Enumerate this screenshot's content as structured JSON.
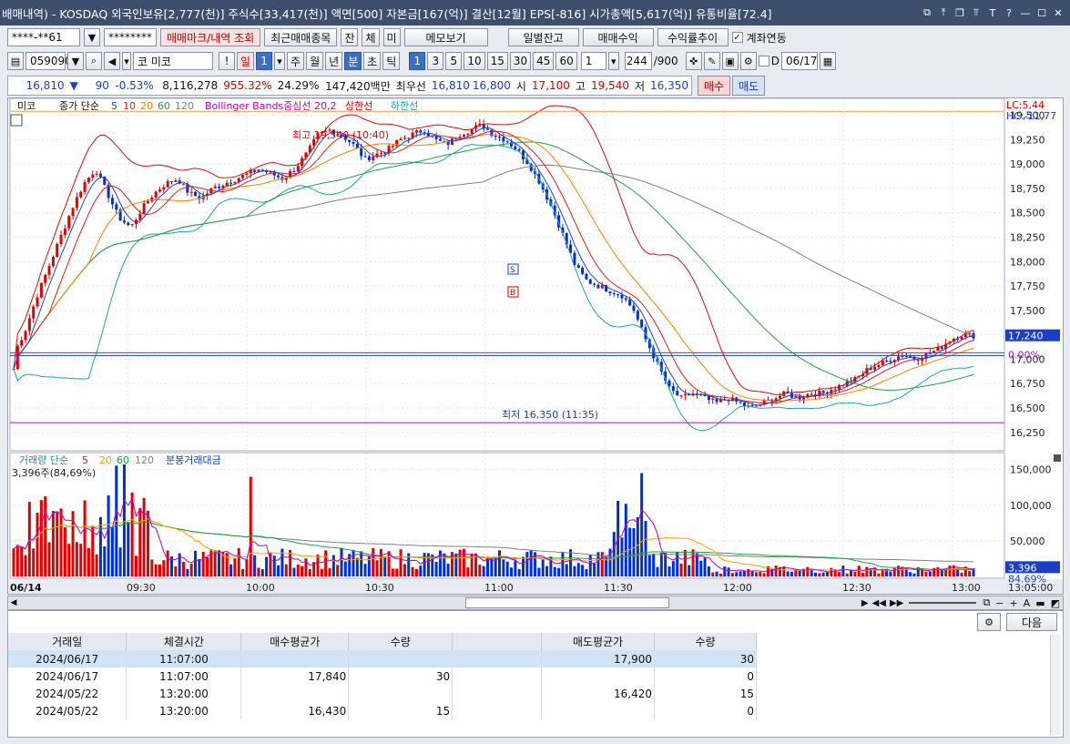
{
  "window": {
    "title": "배매내역) - KOSDAQ 외국인보유[2,777(천)] 주식수[33,417(천)] 액면[500] 자본금[167(억)] 결산[12월] EPS[-816] 시가총액[5,617(억)] 유통비율[72.4]"
  },
  "toolbar1": {
    "account": "****-**61",
    "password": "********",
    "buttons": [
      "매매마크/내역 조회",
      "최근매매종목",
      "잔",
      "체",
      "미",
      "메모보기",
      "일별잔고",
      "매매수익",
      "수익률추이"
    ],
    "link_label": "계좌연동"
  },
  "toolbar2": {
    "code": "059090",
    "name_prefix": "코",
    "name": "미코",
    "periods": [
      "!",
      "일",
      "1",
      "주",
      "월",
      "년",
      "분",
      "초",
      "틱"
    ],
    "minutes": [
      "1",
      "3",
      "5",
      "10",
      "15",
      "30",
      "45",
      "60"
    ],
    "minute_custom": "1",
    "count": "244",
    "count_total": "/900",
    "date_prefix": "D",
    "date": "06/17"
  },
  "quote": {
    "price": "16,810",
    "change": "90",
    "change_pct": "-0.53%",
    "volume": "8,116,278",
    "vol_ratio": "955.32%",
    "turnover": "24.29%",
    "amount": "147,420백만",
    "best_label": "최우선",
    "best_ask": "16,810",
    "best_bid": "16,800",
    "open_label": "시",
    "open": "17,100",
    "high_label": "고",
    "high": "19,540",
    "low_label": "저",
    "low": "16,350",
    "buy_label": "매수",
    "sell_label": "매도"
  },
  "chart_legend": {
    "name": "미코",
    "ma_label": "종가 단순",
    "ma_periods": [
      "5",
      "10",
      "20",
      "60",
      "120"
    ],
    "bb": "Bollinger Bands중심선 20,2",
    "upper": "상한선",
    "lower": "하한선",
    "lc": "LC:5,44",
    "hc": "HC:-11,77",
    "high_mark": "최고 19,540 (10:40)",
    "low_mark": "최저 16,350 (11:35)",
    "last_price_tag": "17,240",
    "zero_pct": "0.00%",
    "vol_legend": "거래량 단순",
    "vol_periods": [
      "5",
      "20",
      "60",
      "120"
    ],
    "vol_amount": "분봉거래대금",
    "vol_value": "3,396주(84,69%)",
    "vol_tag": "3,396",
    "vol_tag_pct": "84.69%",
    "date_label": "06/14"
  },
  "chart_data": {
    "type": "candlestick",
    "y_ticks": [
      "19,500",
      "19,250",
      "19,000",
      "18,750",
      "18,500",
      "18,250",
      "18,000",
      "17,750",
      "17,500",
      "17,250",
      "17,000",
      "16,750",
      "16,500",
      "16,250"
    ],
    "ylim": [
      16080,
      19580
    ],
    "vol_ticks": [
      "150,000",
      "100,000",
      "50,000"
    ],
    "vol_ylim": [
      0,
      170000
    ],
    "x_ticks": [
      "09:30",
      "10:00",
      "10:30",
      "11:00",
      "11:30",
      "12:00",
      "12:30",
      "13:00",
      "13:05:00"
    ],
    "close_path": [
      17050,
      17300,
      17650,
      17950,
      18250,
      18550,
      18800,
      18950,
      18700,
      18450,
      18350,
      18550,
      18700,
      18800,
      18850,
      18700,
      18650,
      18750,
      18800,
      18850,
      18900,
      18950,
      18900,
      18850,
      18950,
      19100,
      19300,
      19350,
      19300,
      19200,
      19050,
      19100,
      19150,
      19250,
      19300,
      19350,
      19250,
      19200,
      19300,
      19350,
      19400,
      19300,
      19250,
      19150,
      19000,
      18800,
      18550,
      18250,
      17950,
      17800,
      17750,
      17700,
      17650,
      17500,
      17200,
      16950,
      16700,
      16600,
      16650,
      16600,
      16550,
      16600,
      16550,
      16500,
      16550,
      16600,
      16650,
      16600,
      16650,
      16650,
      16700,
      16750,
      16800,
      16900,
      16950,
      17000,
      17050,
      17000,
      17050,
      17100,
      17200,
      17250,
      17240
    ]
  },
  "table": {
    "headers": [
      "거래일",
      "체결시간",
      "매수평균가",
      "수량",
      "",
      "매도평균가",
      "수량"
    ],
    "rows": [
      [
        "2024/06/17",
        "11:07:00",
        "",
        "",
        "",
        "17,900",
        "30"
      ],
      [
        "2024/06/17",
        "11:07:00",
        "17,840",
        "30",
        "",
        "",
        "0"
      ],
      [
        "2024/05/22",
        "13:20:00",
        "",
        "",
        "",
        "16,420",
        "15"
      ],
      [
        "2024/05/22",
        "13:20:00",
        "16,430",
        "15",
        "",
        "",
        "0"
      ]
    ],
    "next_label": "다음"
  }
}
